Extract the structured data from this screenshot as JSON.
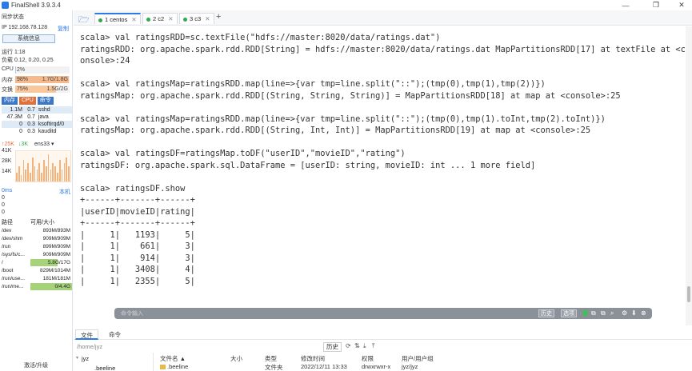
{
  "app": {
    "title": "FinalShell 3.9.3.4",
    "minimize": "—",
    "maximize": "❐",
    "close": "✕"
  },
  "left": {
    "sync_status": "同步状态",
    "ip": "IP 192.168.78.128",
    "copy": "复制",
    "sysinfo_button": "系统信息",
    "uptime": "运行 1:18",
    "load": "负载 0.12, 0.20, 0.25",
    "cpu": {
      "label": "CPU",
      "pct": "2%",
      "fraction": 0.02
    },
    "mem": {
      "label": "内存",
      "pct": "98%",
      "value": "1.7G/1.8G",
      "fraction": 0.98
    },
    "swap": {
      "label": "交换",
      "pct": "75%",
      "value": "1.5G/2G",
      "fraction": 0.75
    },
    "proc_tabs": [
      "内存",
      "CPU",
      "命令"
    ],
    "processes": [
      {
        "mem": "1.1M",
        "cpu": "0.7",
        "cmd": "sshd"
      },
      {
        "mem": "47.3M",
        "cpu": "0.7",
        "cmd": "java"
      },
      {
        "mem": "0",
        "cpu": "0.3",
        "cmd": "ksoftirqd/0"
      },
      {
        "mem": "0",
        "cpu": "0.3",
        "cmd": "kauditd"
      }
    ],
    "net": {
      "up": "↑25K",
      "down": "↓3K",
      "iface": "ens33"
    },
    "net_yticks": [
      "41K",
      "28K",
      "14K"
    ],
    "net_bars": [
      0.3,
      0.5,
      0.2,
      0.7,
      0.4,
      0.6,
      0.3,
      0.8,
      0.5,
      0.4,
      0.6,
      0.3,
      0.7,
      0.5,
      0.9,
      0.4,
      0.6,
      0.5,
      0.3,
      0.7,
      0.4,
      0.6,
      0.8,
      0.5
    ],
    "latency": {
      "ms": "0ms",
      "host": "本机",
      "values": [
        "0",
        "0",
        "0"
      ]
    },
    "disk_headers": [
      "路径",
      "可用/大小"
    ],
    "disks": [
      {
        "path": "/dev",
        "value": "893M/893M",
        "fraction": 0.0
      },
      {
        "path": "/dev/shm",
        "value": "909M/909M",
        "fraction": 0.0
      },
      {
        "path": "/run",
        "value": "899M/909M",
        "fraction": 0.0
      },
      {
        "path": "/sys/fs/c...",
        "value": "909M/909M",
        "fraction": 0.0
      },
      {
        "path": "/",
        "value": "5.8G/17G",
        "fraction": 0.66
      },
      {
        "path": "/boot",
        "value": "829M/1014M",
        "fraction": 0.0
      },
      {
        "path": "/run/use...",
        "value": "181M/181M",
        "fraction": 0.0
      },
      {
        "path": "/run/me...",
        "value": "0/4.4G",
        "fraction": 1.0
      }
    ],
    "upgrade": "激活/升级"
  },
  "tabs": [
    {
      "label": "1 centos"
    },
    {
      "label": "2 c2"
    },
    {
      "label": "3 c3"
    }
  ],
  "terminal": {
    "text": "scala> val ratingsRDD=sc.textFile(\"hdfs://master:8020/data/ratings.dat\")\nratingsRDD: org.apache.spark.rdd.RDD[String] = hdfs://master:8020/data/ratings.dat MapPartitionsRDD[17] at textFile at <c\nonsole>:24\n\nscala> val ratingsMap=ratingsRDD.map(line=>{var tmp=line.split(\"::\");(tmp(0),tmp(1),tmp(2))})\nratingsMap: org.apache.spark.rdd.RDD[(String, String, String)] = MapPartitionsRDD[18] at map at <console>:25\n\nscala> val ratingsMap=ratingsRDD.map(line=>{var tmp=line.split(\"::\");(tmp(0),tmp(1).toInt,tmp(2).toInt)})\nratingsMap: org.apache.spark.rdd.RDD[(String, Int, Int)] = MapPartitionsRDD[19] at map at <console>:25\n\nscala> val ratingsDF=ratingsMap.toDF(\"userID\",\"movieID\",\"rating\")\nratingsDF: org.apache.spark.sql.DataFrame = [userID: string, movieID: int ... 1 more field]\n\nscala> ratingsDF.show\n+------+-------+------+\n|userID|movieID|rating|\n+------+-------+------+\n|     1|   1193|     5|\n|     1|    661|     3|\n|     1|    914|     3|\n|     1|   3408|     4|\n|     1|   2355|     5|",
    "input_placeholder": "命令输入",
    "history_btn": "历史",
    "options_btn": "选项"
  },
  "bottom": {
    "tabs": [
      "文件",
      "命令"
    ],
    "path": "/home/jyz",
    "history": "历史",
    "tree_root": "jyz",
    "tree_child": ".beeline",
    "file_headers": [
      "文件名 ▲",
      "大小",
      "类型",
      "修改时间",
      "权限",
      "用户/用户组"
    ],
    "file_row": {
      "name": ".beeline",
      "size": "",
      "type": "文件夹",
      "mtime": "2022/12/11 13:33",
      "perm": "drwxrwxr-x",
      "owner": "jyz/jyz"
    }
  }
}
